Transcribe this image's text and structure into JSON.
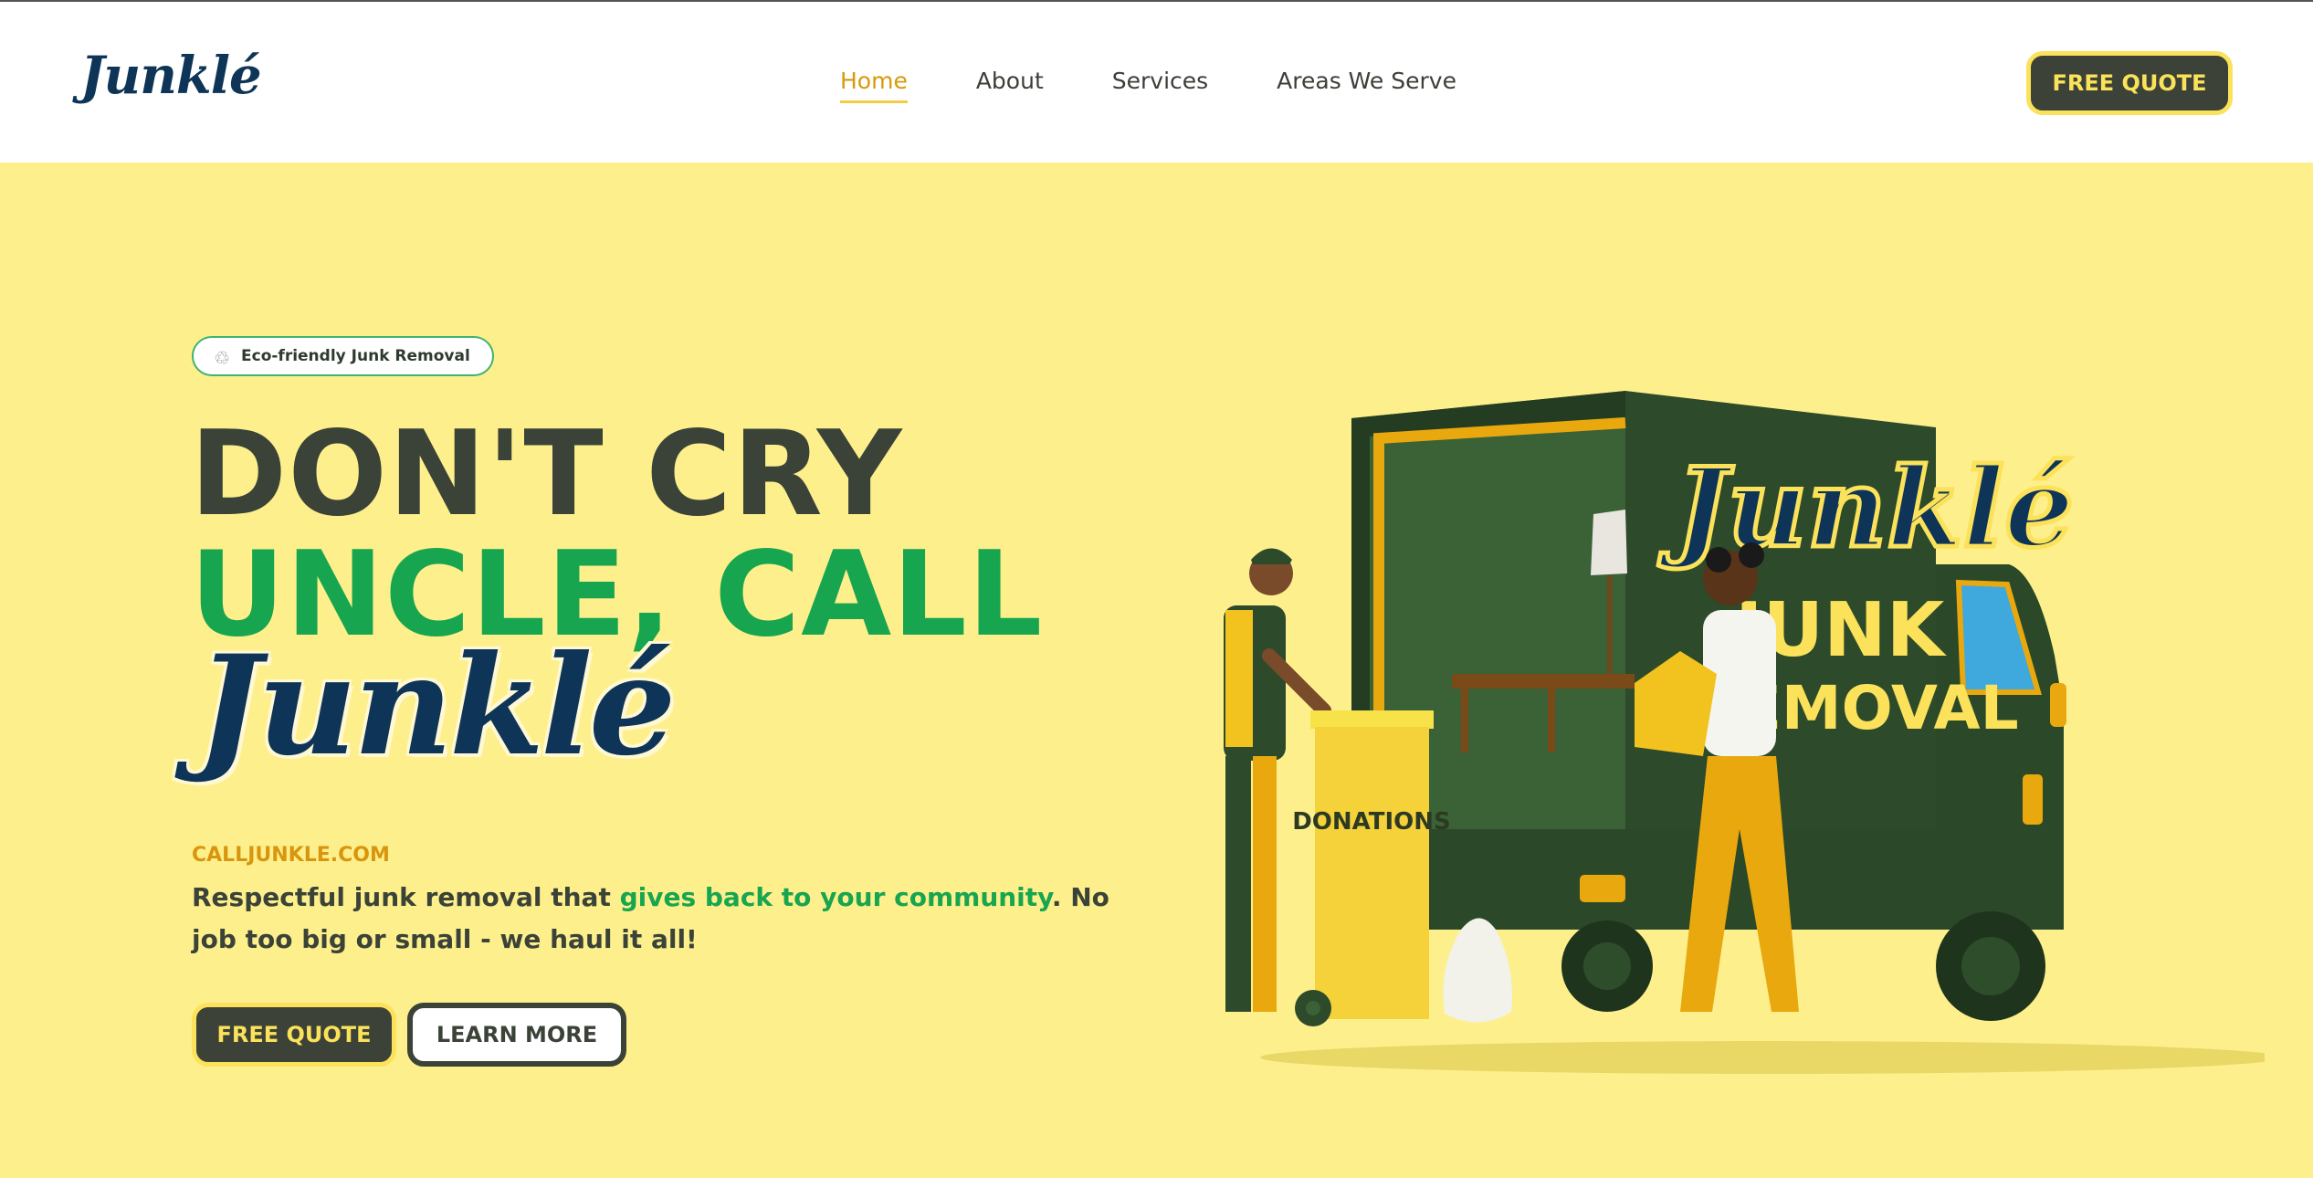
{
  "header": {
    "logo": "Junklé",
    "nav": [
      {
        "label": "Home",
        "active": true
      },
      {
        "label": "About",
        "active": false
      },
      {
        "label": "Services",
        "active": false
      },
      {
        "label": "Areas We Serve",
        "active": false
      }
    ],
    "quote_button": "FREE QUOTE"
  },
  "hero": {
    "badge": "Eco-friendly Junk Removal",
    "headline_line1": "DON'T CRY",
    "headline_line2": "UNCLE, CALL",
    "headline_brand": "Junklé",
    "website": "CALLJUNKLE.COM",
    "description_start": "Respectful junk removal that ",
    "description_highlight": "gives back to your community",
    "description_end": ". No job too big or small - we haul it all!",
    "primary_button": "FREE QUOTE",
    "secondary_button": "LEARN MORE"
  },
  "illustration": {
    "truck_logo": "Junklé",
    "truck_line1": "JUNK",
    "truck_line2": "REMOVAL",
    "bin_label": "DONATIONS"
  },
  "colors": {
    "background": "#fdf08c",
    "dark": "#3b4238",
    "green": "#18a54f",
    "navy": "#0e3557",
    "gold": "#d8950d",
    "yellow": "#fbe25a",
    "truck": "#2d4a2a"
  }
}
